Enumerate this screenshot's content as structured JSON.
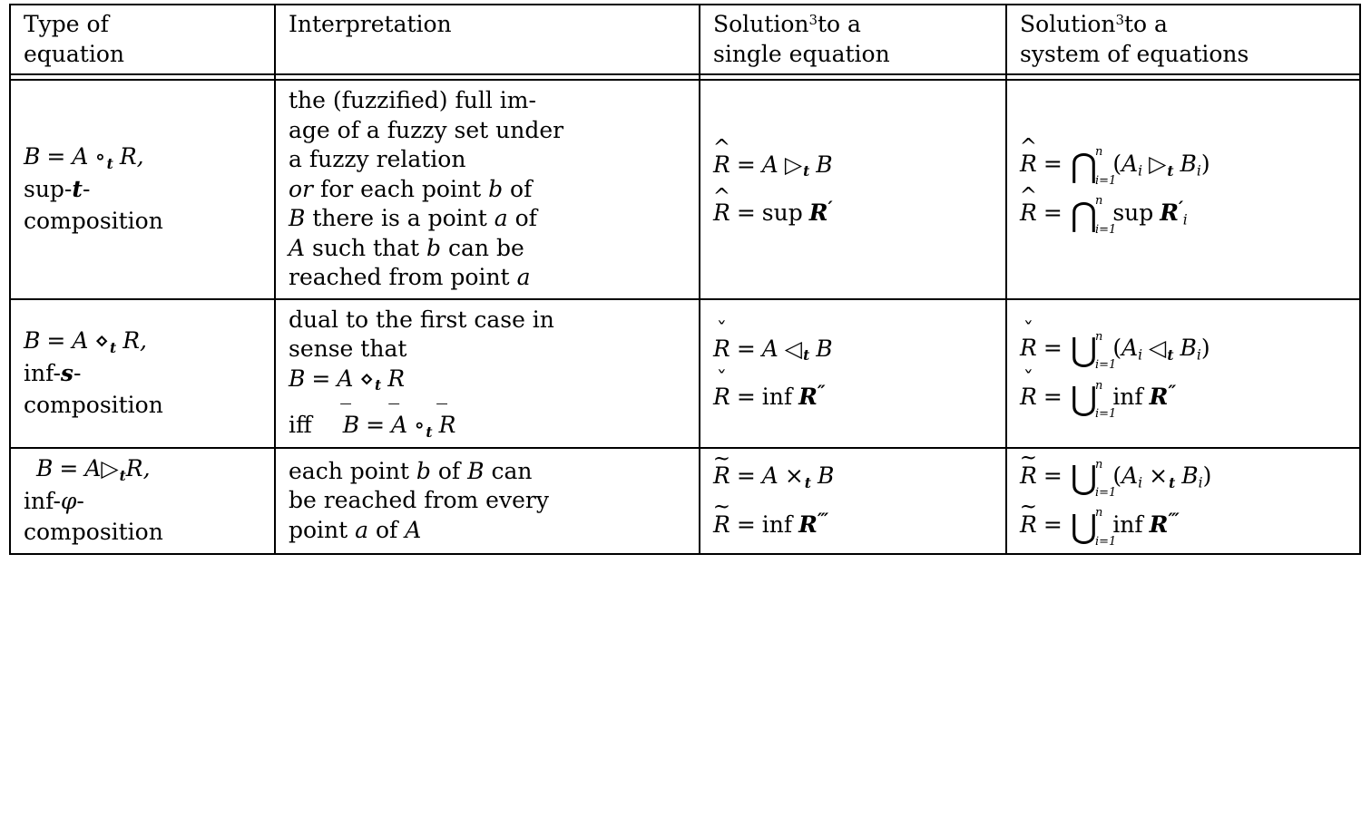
{
  "table": {
    "headers": [
      {
        "line1": "Type of",
        "line2": "equation"
      },
      {
        "line1": "Interpretation",
        "line2": ""
      },
      {
        "line1_a": "Solution",
        "line1_sup": "3",
        "line1_b": "to a",
        "line2": "single equation"
      },
      {
        "line1_a": "Solution",
        "line1_sup": "3",
        "line1_b": "to a",
        "line2": "system of equations"
      }
    ],
    "rows": [
      {
        "equation": {
          "line1": {
            "lhs": "B",
            "eq": "=",
            "a": "A",
            "op": "∘",
            "sub": "t",
            "rhs": "R,"
          },
          "line2_prefix": "sup-",
          "line2_sub": "t",
          "line2_suffix": "-",
          "line3": "composition"
        },
        "interpretation": {
          "paragraph1": [
            "the (fuzzified) full im-",
            "age of a fuzzy set under",
            "a fuzzy relation"
          ],
          "or_word": "or",
          "paragraph2": [
            " for each point b of",
            "B there is a point a of",
            "A such that b can be",
            "reached from point a"
          ]
        },
        "single": {
          "eq1": {
            "lhs": "R",
            "accent": "hat",
            "eq": "=",
            "a": "A",
            "op": "▷",
            "sub": "t",
            "b": "B"
          },
          "eq2": {
            "lhs": "R",
            "accent": "hat",
            "eq": "=",
            "fn": "sup",
            "arg": "R",
            "primes": "′"
          }
        },
        "system": {
          "eq1": {
            "lhs": "R",
            "accent": "hat",
            "eq": "=",
            "bigop": "⋂",
            "top": "n",
            "bot": "i=1",
            "inner": "(A_i ▷_t B_i)"
          },
          "eq2": {
            "lhs": "R",
            "accent": "hat",
            "eq": "=",
            "bigop": "⋂",
            "top": "n",
            "bot": "i=1",
            "fn": "sup",
            "arg": "R",
            "primes": "′",
            "argsub": "i"
          }
        }
      },
      {
        "equation": {
          "line1": {
            "lhs": "B",
            "eq": "=",
            "a": "A",
            "op": "⋄",
            "sub": "t",
            "rhs": "R,"
          },
          "line2_prefix": "inf-",
          "line2_sub": "s",
          "line2_suffix": "-",
          "line3": "composition"
        },
        "interpretation": {
          "paragraph1": [
            "dual to the first case in",
            "sense that"
          ],
          "formula1": {
            "lhs": "B",
            "eq": "=",
            "a": "A",
            "op": "⋄",
            "sub": "t",
            "rhs": "R"
          },
          "iff_word": "iff",
          "formula2": {
            "lhs": "B",
            "eq": "=",
            "a": "A",
            "op": "∘",
            "sub": "t",
            "rhs": "R"
          }
        },
        "single": {
          "eq1": {
            "lhs": "R",
            "accent": "chk",
            "eq": "=",
            "a": "A",
            "op": "◁",
            "sub": "t",
            "b": "B"
          },
          "eq2": {
            "lhs": "R",
            "accent": "chk",
            "eq": "=",
            "fn": "inf",
            "arg": "R",
            "primes": "″"
          }
        },
        "system": {
          "eq1": {
            "lhs": "R",
            "accent": "chk",
            "eq": "=",
            "bigop": "⋃",
            "top": "n",
            "bot": "i=1",
            "inner": "(A_i ◁_t B_i)"
          },
          "eq2": {
            "lhs": "R",
            "accent": "chk",
            "eq": "=",
            "bigop": "⋃",
            "top": "n",
            "bot": "i=1",
            "fn": "inf",
            "arg": "R",
            "primes": "″"
          }
        }
      },
      {
        "equation": {
          "line1": {
            "lhs": "B",
            "eq": "=",
            "a": "A",
            "op": "▷",
            "sub": "t",
            "rhs": "R,"
          },
          "line2_prefix": "inf-",
          "line2_sub": "φ",
          "line2_suffix": "-",
          "line3": "composition"
        },
        "interpretation": {
          "paragraph1": [
            "each point b of B can",
            "be reached from every",
            "point a of A"
          ]
        },
        "single": {
          "eq1": {
            "lhs": "R",
            "accent": "tld",
            "eq": "=",
            "a": "A",
            "op": "×",
            "sub": "t",
            "b": "B"
          },
          "eq2": {
            "lhs": "R",
            "accent": "tld",
            "eq": "=",
            "fn": "inf",
            "arg": "R",
            "primes": "‴"
          }
        },
        "system": {
          "eq1": {
            "lhs": "R",
            "accent": "tld",
            "eq": "=",
            "bigop": "⋃",
            "top": "n",
            "bot": "i=1",
            "inner": "(A_i ×_t B_i)"
          },
          "eq2": {
            "lhs": "R",
            "accent": "tld",
            "eq": "=",
            "bigop": "⋃",
            "top": "n",
            "bot": "i=1",
            "fn": "inf",
            "arg": "R",
            "primes": "‴"
          }
        }
      }
    ]
  },
  "colors": {
    "rule": "#000000",
    "text": "#000000",
    "background": "#ffffff"
  }
}
